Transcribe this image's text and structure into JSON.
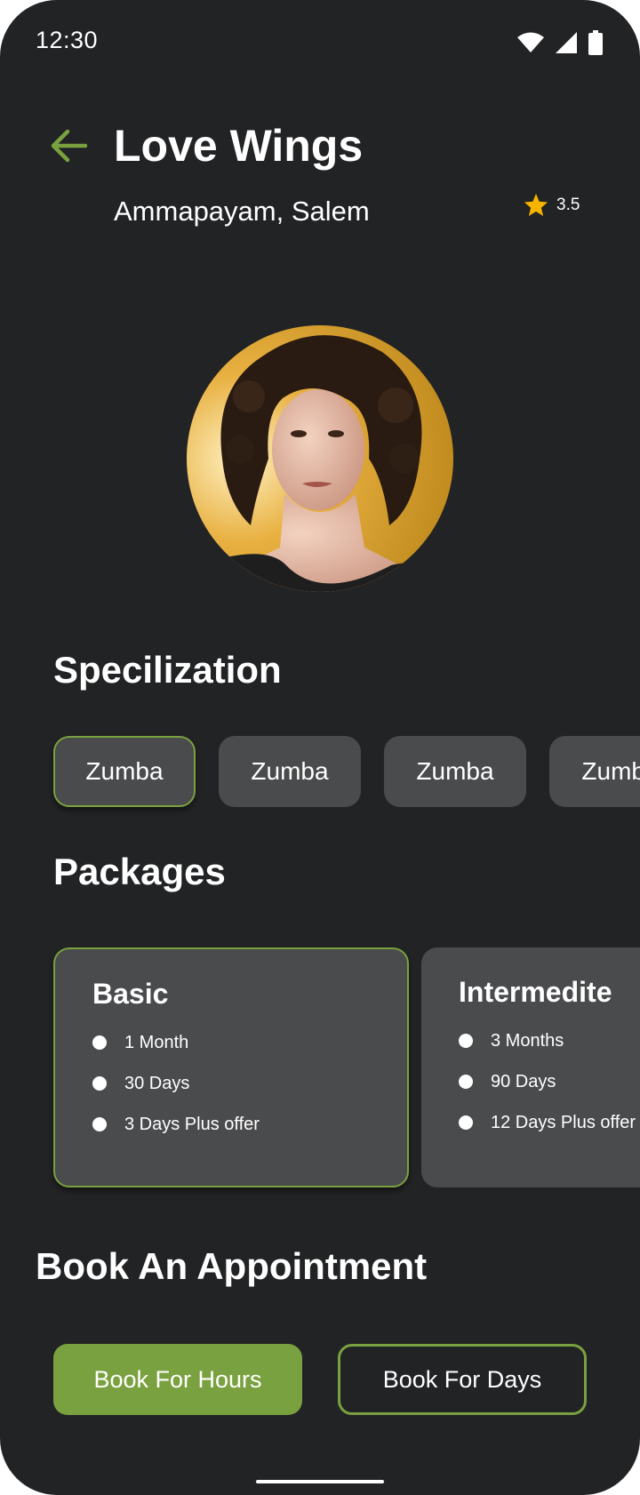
{
  "status_bar": {
    "time": "12:30",
    "icons": [
      "wifi-icon",
      "cellular-signal-icon",
      "battery-icon"
    ]
  },
  "header": {
    "back_icon": "arrow-left-icon",
    "title": "Love Wings",
    "location": "Ammapayam, Salem",
    "rating_icon": "star-icon",
    "rating": "3.5"
  },
  "profile": {
    "avatar": "profile-photo"
  },
  "specialization": {
    "title": "Specilization",
    "chips": [
      {
        "label": "Zumba",
        "selected": true
      },
      {
        "label": "Zumba",
        "selected": false
      },
      {
        "label": "Zumba",
        "selected": false
      },
      {
        "label": "Zumba",
        "selected": false
      }
    ]
  },
  "packages": {
    "title": "Packages",
    "items": [
      {
        "name": "Basic",
        "features": [
          "1 Month",
          "30 Days",
          "3 Days Plus offer"
        ],
        "selected": true
      },
      {
        "name": "Intermedite",
        "features": [
          "3 Months",
          "90 Days",
          "12 Days Plus offer"
        ],
        "selected": false
      }
    ]
  },
  "booking": {
    "title": "Book An Appointment",
    "hours_label": "Book For Hours",
    "days_label": "Book For Days"
  },
  "colors": {
    "background": "#222325",
    "surface": "#4a4b4d",
    "accent": "#7aa13f",
    "star": "#f4b400",
    "text": "#ffffff"
  }
}
